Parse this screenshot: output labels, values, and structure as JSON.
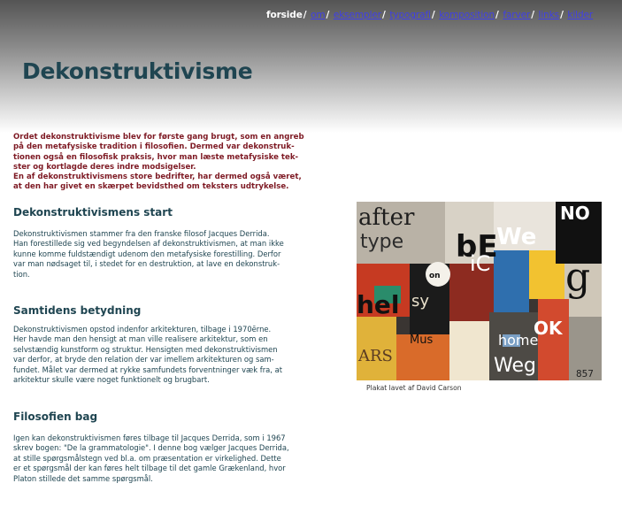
{
  "nav": {
    "items": [
      {
        "label": "forside",
        "current": true
      },
      {
        "label": "om",
        "current": false
      },
      {
        "label": "eksempler",
        "current": false
      },
      {
        "label": "typografi",
        "current": false
      },
      {
        "label": "komposition",
        "current": false
      },
      {
        "label": "farver",
        "current": false
      },
      {
        "label": "links",
        "current": false
      },
      {
        "label": "kilder",
        "current": false
      }
    ],
    "separator": "/"
  },
  "page": {
    "title": "Dekonstruktivisme"
  },
  "intro": {
    "lines": [
      "Ordet dekonstruktivisme blev for første gang brugt, som en angreb",
      "på den metafysiske tradition i filosofien.  Dermed var dekonstruk-",
      "tionen også en filosofisk praksis, hvor man læste metafysiske tek-",
      "ster og kortlagde deres indre modsigelser.",
      "En af dekonstruktivismens store bedrifter, har dermed også været,",
      "at den har givet en skærpet bevidsthed om teksters udtrykelse."
    ]
  },
  "sections": [
    {
      "title": "Dekonstruktivismens start",
      "lines": [
        "Dekonstruktivismen stammer fra den franske filosof Jacques Derrida.",
        "Han forestillede sig ved begyndelsen af dekonstruktivismen, at man ikke",
        "kunne komme fuldstændigt udenom den metafysiske forestilling. Derfor",
        "var man nødsaget til, i stedet for en destruktion, at lave en dekonstruk-",
        "tion."
      ]
    },
    {
      "title": "Samtidens betydning",
      "lines": [
        "Dekonstruktivismen opstod indenfor arkitekturen, tilbage i 1970ērne.",
        "Her havde man den hensigt at man ville realisere arkitektur, som en",
        "selvstændig kunstform og struktur. Hensigten med dekonstruktivismen",
        "var derfor, at bryde den relation der var imellem arkitekturen og sam-",
        "fundet. Målet var dermed at rykke samfundets forventninger væk fra, at",
        "arkitektur skulle være noget funktionelt og brugbart."
      ]
    },
    {
      "title": "Filosofien bag",
      "lines": [
        "Igen kan dekonstruktivismen føres tilbage til Jacques Derrida, som i 1967",
        "skrev bogen: \"De la grammatologie\". I denne bog vælger Jacques Derrida,",
        "at stille spørgsmålstegn ved bl.a. om præsentation er virkelighed. Dette",
        "er et spørgsmål der kan føres helt tilbage til det gamle Grækenland, hvor",
        "Platon stillede det samme spørgsmål."
      ]
    }
  ],
  "figure": {
    "caption": "Plakat lavet af David Carson",
    "poster_text": [
      "NO",
      "after",
      "type",
      "bE",
      "We",
      "iC",
      "g",
      "hel",
      "sy",
      "ARS",
      "home",
      "Weg",
      "857",
      "OK",
      "on",
      "Mus"
    ],
    "colors": {
      "accent": "#7e1a24",
      "heading": "#1f4551",
      "nav_link": "#3f3fe8"
    }
  }
}
